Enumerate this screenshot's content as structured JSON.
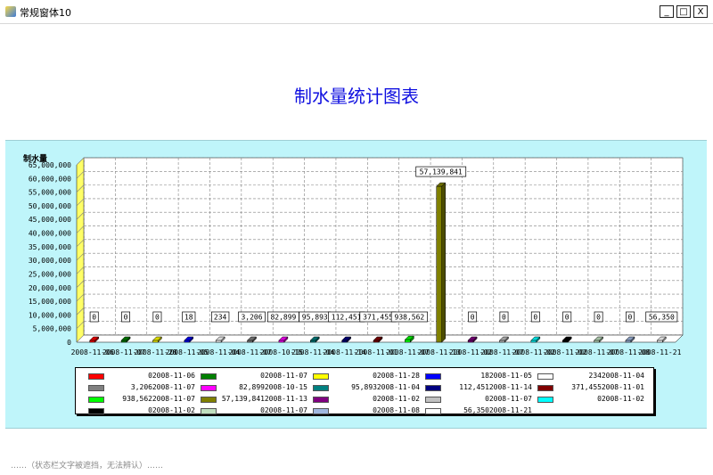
{
  "window": {
    "title": "常规窗体10",
    "minimize": "_",
    "maximize": "□",
    "close": "X"
  },
  "page": {
    "title": "制水量统计图表"
  },
  "status_text": "……（状态栏文字被遮挡，无法辨认）……",
  "chart_data": {
    "type": "bar",
    "title": "",
    "ylabel": "制水量",
    "xlabel": "",
    "ylim": [
      0,
      65000000
    ],
    "yticks": [
      "0",
      "5,000,000",
      "10,000,000",
      "15,000,000",
      "20,000,000",
      "25,000,000",
      "30,000,000",
      "35,000,000",
      "40,000,000",
      "45,000,000",
      "50,000,000",
      "55,000,000",
      "60,000,000",
      "65,000,000"
    ],
    "grid": true,
    "legend_position": "bottom",
    "categories": [
      "2008-11-06",
      "2008-11-07",
      "2008-11-28",
      "2008-11-05",
      "2008-11-04",
      "2008-11-07",
      "2008-10-15",
      "2008-11-04",
      "2008-11-14",
      "2008-11-01",
      "2008-11-07",
      "2008-11-13",
      "2008-11-02",
      "2008-11-07",
      "2008-11-02",
      "2008-11-02",
      "2008-11-07",
      "2008-11-08",
      "2008-11-21"
    ],
    "values": [
      0,
      0,
      0,
      18,
      234,
      3206,
      82899,
      95893,
      112451,
      371455,
      938562,
      57139841,
      0,
      0,
      0,
      0,
      0,
      0,
      56350
    ],
    "value_labels": [
      "0",
      "0",
      "0",
      "18",
      "234",
      "3,206",
      "82,899",
      "95,893",
      "112,451",
      "371,455",
      "938,562",
      "57,139,841",
      "0",
      "0",
      "0",
      "0",
      "0",
      "0",
      "56,350"
    ],
    "colors": [
      "#ff0000",
      "#008000",
      "#ffff00",
      "#0000ff",
      "#ffffff",
      "#808080",
      "#ff00ff",
      "#008080",
      "#000080",
      "#800000",
      "#00ff00",
      "#808000",
      "#800080",
      "#c0c0c0",
      "#00ffff",
      "#000000",
      "#c0e0c0",
      "#a0b8e0",
      "#ffffff"
    ]
  }
}
